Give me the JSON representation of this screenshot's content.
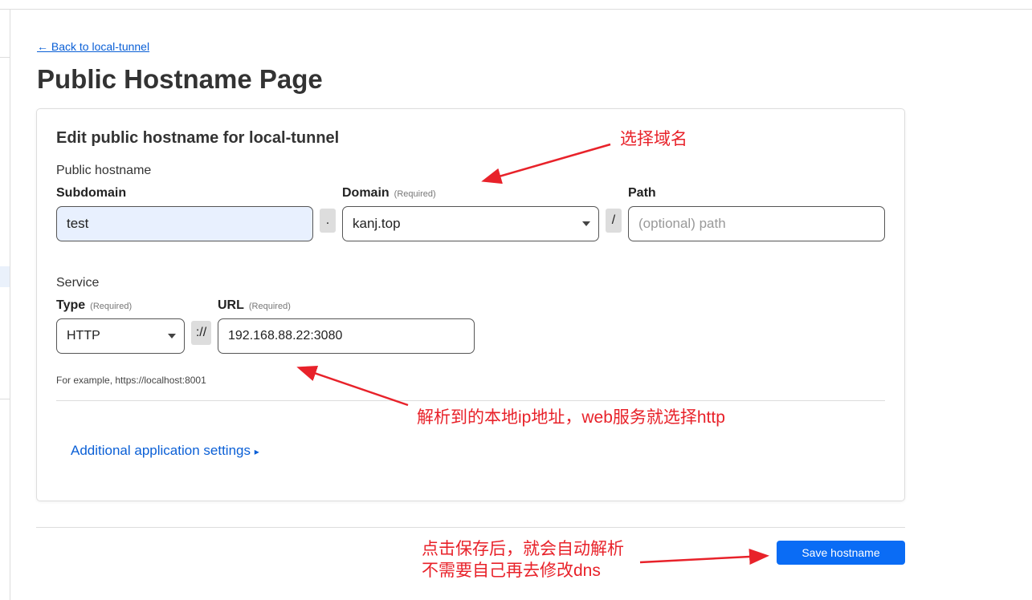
{
  "back_link": "← Back to local-tunnel",
  "page_title": "Public Hostname Page",
  "card": {
    "title": "Edit public hostname for local-tunnel",
    "public_hostname_label": "Public hostname",
    "subdomain": {
      "label": "Subdomain",
      "value": "test"
    },
    "dot": ".",
    "domain": {
      "label": "Domain",
      "required": "(Required)",
      "value": "kanj.top"
    },
    "slash": "/",
    "path": {
      "label": "Path",
      "placeholder": "(optional) path"
    },
    "service_label": "Service",
    "type": {
      "label": "Type",
      "required": "(Required)",
      "value": "HTTP"
    },
    "scheme_sep": "://",
    "url": {
      "label": "URL",
      "required": "(Required)",
      "value": "192.168.88.22:3080"
    },
    "hint": "For example, https://localhost:8001",
    "additional": "Additional application settings",
    "additional_icon": "▸"
  },
  "save_button": "Save hostname",
  "annotations": {
    "domain": "选择域名",
    "url": "解析到的本地ip地址，web服务就选择http",
    "save_line1": "点击保存后，就会自动解析",
    "save_line2": "不需要自己再去修改dns"
  },
  "colors": {
    "accent": "#0a6cf5",
    "annotation": "#e8222a"
  }
}
